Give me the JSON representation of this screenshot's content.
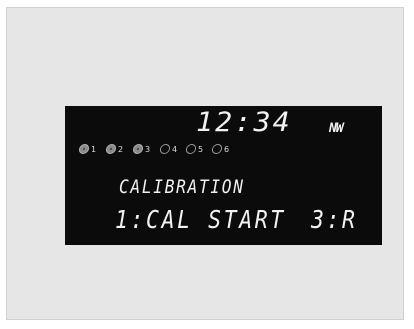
{
  "display": {
    "clock": "12:34",
    "indicator": "NW",
    "line1": "CALIBRATION",
    "line2_left": "1:CAL START",
    "line2_right": "3:R"
  },
  "discs": [
    {
      "number": "1",
      "loaded": true
    },
    {
      "number": "2",
      "loaded": true
    },
    {
      "number": "3",
      "loaded": true
    },
    {
      "number": "4",
      "loaded": false
    },
    {
      "number": "5",
      "loaded": false
    },
    {
      "number": "6",
      "loaded": false
    }
  ],
  "colors": {
    "background": "#e6e6e6",
    "lcd": "#0b0b0b",
    "segment": "#f2f2f2"
  }
}
